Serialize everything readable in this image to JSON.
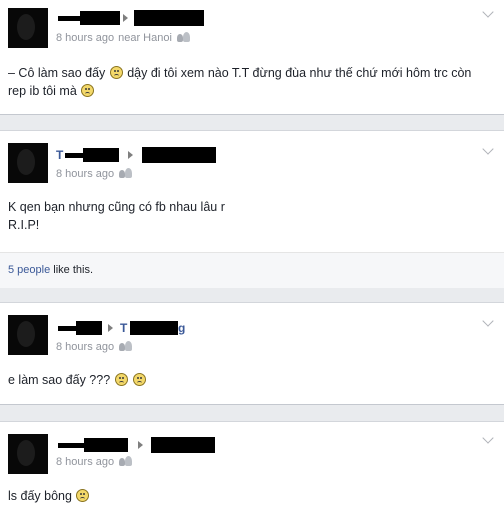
{
  "posts": [
    {
      "time": "8 hours ago",
      "location": "near Hanoi",
      "message_parts": [
        "– Cô làm sao đấy ",
        " dậy đi tôi xem nào T.T đừng đùa như thế chứ mới hôm trc còn rep ib tôi mà "
      ]
    },
    {
      "name_fragment": "T",
      "time": "8 hours ago",
      "message_lines": [
        "K qen bạn nhưng cũng có fb nhau lâu r",
        "R.I.P!"
      ],
      "likes": {
        "link": "5 people",
        "text": " like this."
      }
    },
    {
      "target_fragment": "T",
      "target_suffix": "g",
      "time": "8 hours ago",
      "message_parts": [
        "e làm sao đấy ??? "
      ]
    },
    {
      "time": "8 hours ago",
      "message_parts": [
        "ls đấy bông "
      ]
    }
  ],
  "icons": {
    "avatar": "profile-photo",
    "arrow": "right-triangle-icon",
    "audience": "friends-icon",
    "options": "chevron-down-icon",
    "emoji": "frown-emoticon"
  },
  "colors": {
    "link": "#3b5998",
    "meta": "#90949c",
    "background": "#e9ebee"
  }
}
